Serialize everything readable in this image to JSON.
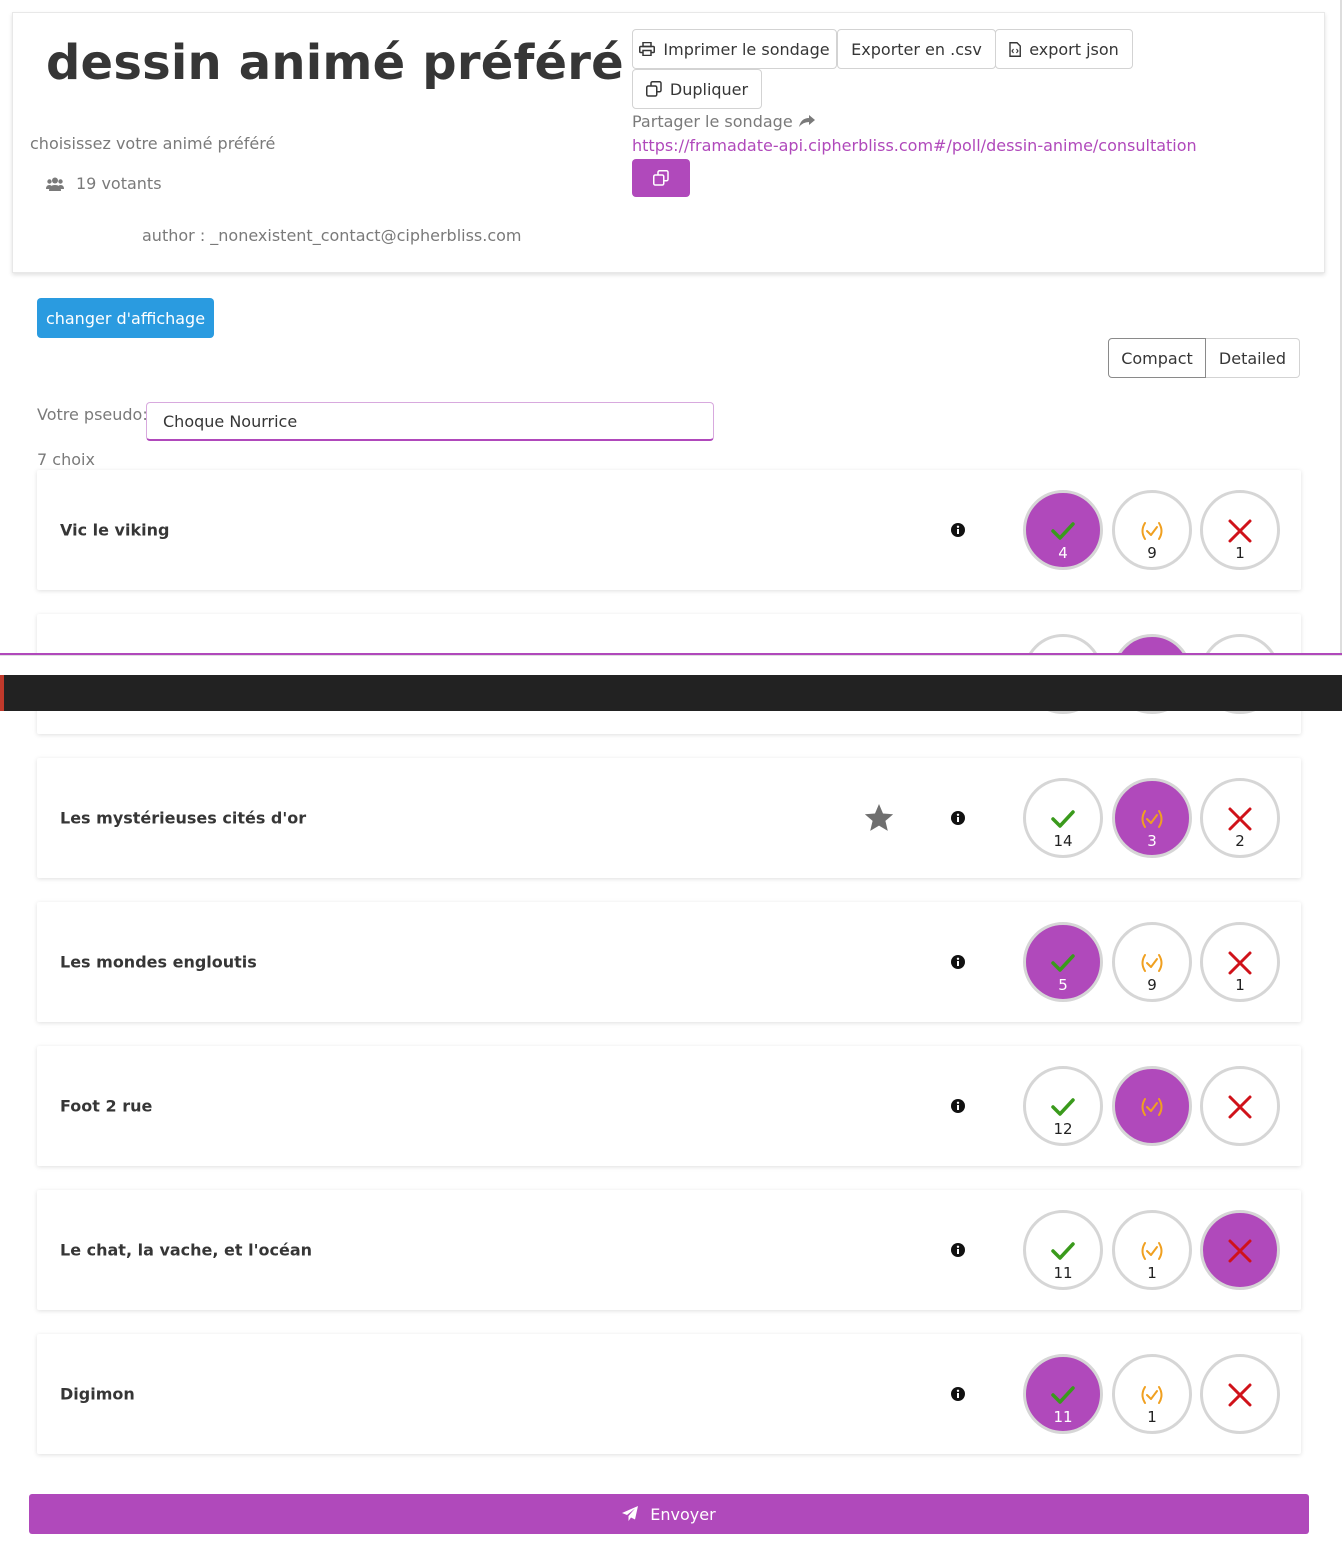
{
  "poll": {
    "title": "dessin animé préféré",
    "description": "choisissez votre animé préféré",
    "voters": "19 votants",
    "author": "author : _nonexistent_contact@cipherbliss.com"
  },
  "actions": {
    "print_label": "Imprimer le sondage",
    "export_csv_label": "Exporter en .csv",
    "export_json_label": "export json",
    "duplicate_label": "Dupliquer"
  },
  "share": {
    "label": "Partager le sondage",
    "url": "https://framadate-api.cipherbliss.com#/poll/dessin-anime/consultation"
  },
  "display": {
    "change_label": "changer d'affichage",
    "compact_label": "Compact",
    "detailed_label": "Detailed"
  },
  "form": {
    "pseudo_label": "Votre pseudo:",
    "pseudo_value": "Choque Nourrice",
    "choices_count": "7 choix",
    "submit_label": "Envoyer"
  },
  "choices": [
    {
      "label": "Vic le viking",
      "yes": "4",
      "maybe": "9",
      "no": "1",
      "selected": "yes",
      "starred": false
    },
    {
      "label": "",
      "yes": "",
      "maybe": "",
      "no": "",
      "selected": "maybe",
      "starred": false
    },
    {
      "label": "Les mystérieuses cités d'or",
      "yes": "14",
      "maybe": "3",
      "no": "2",
      "selected": "maybe",
      "starred": true
    },
    {
      "label": "Les mondes engloutis",
      "yes": "5",
      "maybe": "9",
      "no": "1",
      "selected": "yes",
      "starred": false
    },
    {
      "label": "Foot 2 rue",
      "yes": "12",
      "maybe": "",
      "no": "",
      "selected": "maybe",
      "starred": false
    },
    {
      "label": "Le chat, la vache, et l'océan",
      "yes": "11",
      "maybe": "1",
      "no": "",
      "selected": "no",
      "starred": false
    },
    {
      "label": "Digimon",
      "yes": "11",
      "maybe": "1",
      "no": "",
      "selected": "yes",
      "starred": false
    }
  ],
  "colors": {
    "accent": "#b049bb",
    "info_blue": "#2a9be0",
    "yes_green": "#3a9a1c",
    "maybe_orange": "#f0a020",
    "no_red": "#d0121a"
  }
}
